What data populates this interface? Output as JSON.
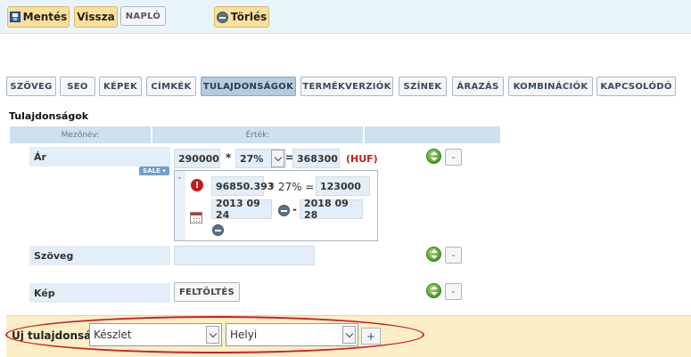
{
  "toolbar": {
    "save_label": "Mentés",
    "back_label": "Vissza",
    "log_label": "NAPLÓ",
    "delete_label": "Törlés"
  },
  "tabs": [
    {
      "label": "SZÖVEG",
      "active": false
    },
    {
      "label": "SEO",
      "active": false
    },
    {
      "label": "KÉPEK",
      "active": false
    },
    {
      "label": "CÍMKÉK",
      "active": false
    },
    {
      "label": "TULAJDONSÁGOK",
      "active": true
    },
    {
      "label": "TERMÉKVERZIÓK",
      "active": false
    },
    {
      "label": "SZÍNEK",
      "active": false
    },
    {
      "label": "ÁRAZÁS",
      "active": false
    },
    {
      "label": "KOMBINÁCIÓK",
      "active": false
    },
    {
      "label": "KAPCSOLÓDÓ",
      "active": false
    }
  ],
  "properties": {
    "title": "Tulajdonságok",
    "col_name": "Mezőnév:",
    "col_value": "Érték:",
    "price": {
      "label": "Ár",
      "net": "290000",
      "times": "*",
      "vat": "27%",
      "equals": "=",
      "gross": "368300",
      "currency": "(HUF)",
      "sale_badge": "SALE ▾",
      "sale": {
        "net": "96850.393",
        "times_vat": "* 27% =",
        "gross": "123000",
        "date_from": "2013 09 24",
        "dash": "-",
        "date_to": "2018 09 28"
      }
    },
    "text_row": {
      "label": "Szöveg",
      "value": ""
    },
    "image_row": {
      "label": "Kép",
      "upload_label": "FELTÖLTÉS"
    },
    "row_remove_label": "-"
  },
  "new_property": {
    "label": "Új tulajdonság",
    "type_value": "Készlet",
    "scope_value": "Helyi",
    "add_label": "+"
  },
  "colors": {
    "accent_yellow": "#fbdf9c",
    "active_tab": "#b5cbe0",
    "currency_red": "#c2261d",
    "highlight": "#d31e26"
  }
}
